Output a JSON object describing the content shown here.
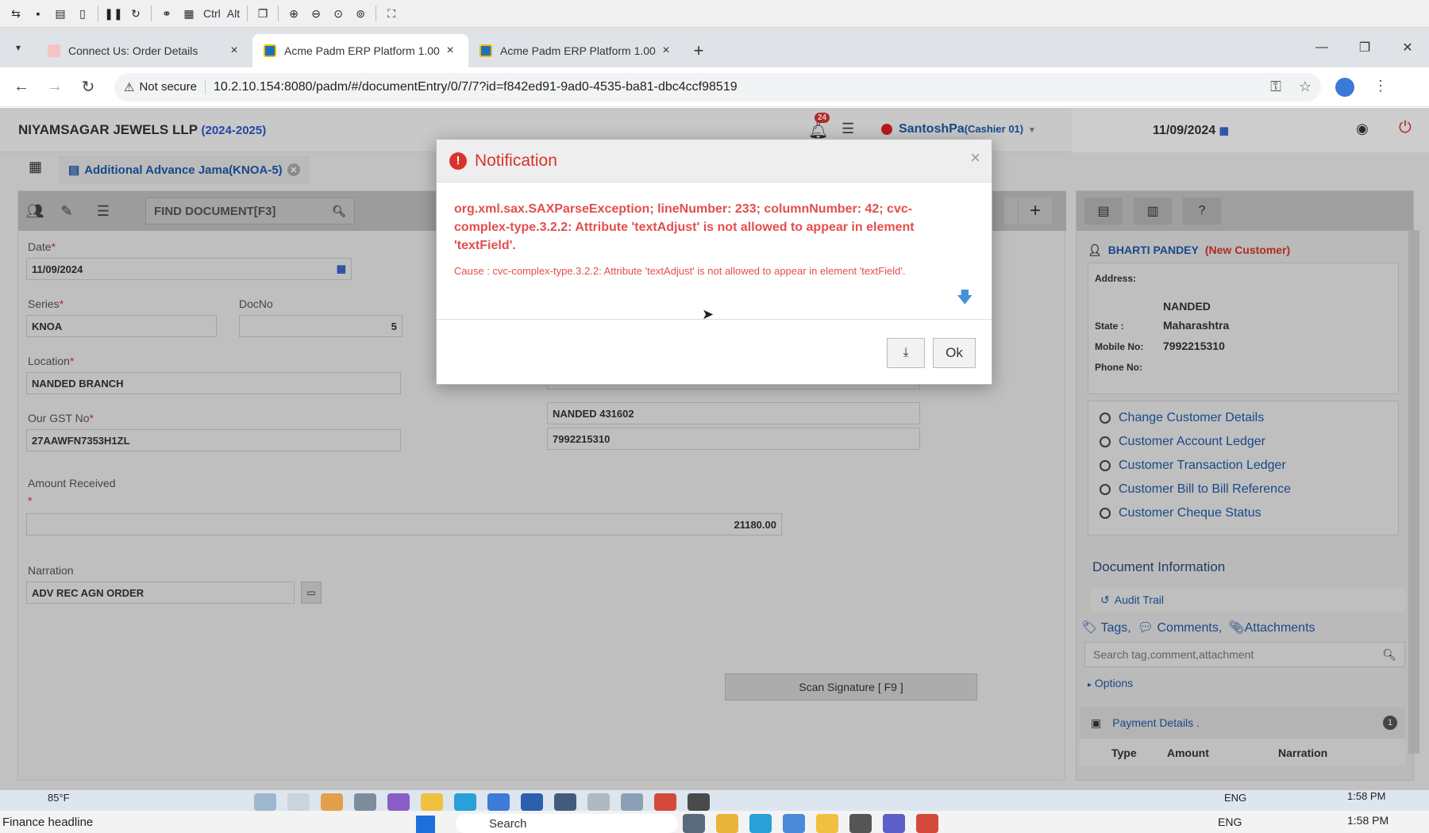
{
  "remote_toolbar": {
    "ctrl": "Ctrl",
    "alt": "Alt"
  },
  "browser": {
    "tabs": [
      {
        "title": "Connect Us: Order Details",
        "active": false
      },
      {
        "title": "Acme Padm ERP Platform 1.00",
        "active": true
      },
      {
        "title": "Acme Padm ERP Platform 1.00",
        "active": false
      }
    ],
    "security": "Not secure",
    "url": "10.2.10.154:8080/padm/#/documentEntry/0/7/7?id=f842ed91-9ad0-4535-ba81-dbc4ccf98519"
  },
  "header": {
    "company": "NIYAMSAGAR JEWELS LLP",
    "fin_year": "(2024-2025)",
    "notif_count": "24",
    "user": "SantoshPa",
    "role": "(Cashier 01)",
    "date": "11/09/2024"
  },
  "doc_tab": {
    "label": "Additional Advance Jama(KNOA-5)"
  },
  "toolbar": {
    "find_placeholder": "FIND DOCUMENT[F3]"
  },
  "form": {
    "date_label": "Date",
    "date_value": "11/09/2024",
    "series_label": "Series",
    "series_value": "KNOA",
    "docno_label": "DocNo",
    "docno_value": "5",
    "location_label": "Location",
    "location_value": "NANDED BRANCH",
    "gst_label": "Our GST No",
    "gst_value": "27AAWFN7353H1ZL",
    "amount_label": "Amount Received",
    "amount_value": "21180.00",
    "narration_label": "Narration",
    "narration_value": "ADV REC AGN ORDER",
    "addr_line": "NANDED 431602",
    "phone_line": "7992215310",
    "scan_signature": "Scan Signature [ F9 ]"
  },
  "customer": {
    "name": "BHARTI PANDEY",
    "tag": "(New Customer)",
    "address_label": "Address:",
    "city": "NANDED",
    "state_label": "State :",
    "state": "Maharashtra",
    "mobile_label": "Mobile No:",
    "mobile": "7992215310",
    "phone_label": "Phone No:",
    "links": [
      "Change Customer Details",
      "Customer Account Ledger",
      "Customer Transaction Ledger",
      "Customer Bill to Bill Reference",
      "Customer Cheque Status"
    ]
  },
  "doc_info": {
    "title": "Document Information",
    "audit_trail": "Audit Trail",
    "tags": "Tags,",
    "comments": "Comments,",
    "attachments": "Attachments",
    "search_placeholder": "Search tag,comment,attachment",
    "options": "Options",
    "payment_details": "Payment Details .",
    "payment_count": "1",
    "columns": [
      "Type",
      "Amount",
      "Narration"
    ]
  },
  "dialog": {
    "title": "Notification",
    "message": "org.xml.sax.SAXParseException; lineNumber: 233; columnNumber: 42; cvc-complex-type.3.2.2: Attribute 'textAdjust' is not allowed to appear in element 'textField'.",
    "cause": "Cause : cvc-complex-type.3.2.2: Attribute 'textAdjust' is not allowed to appear in element 'textField'.",
    "ok": "Ok"
  },
  "inner_taskbar": {
    "temp": "85°F",
    "lang": "ENG",
    "time": "1:58 PM"
  },
  "outer_taskbar": {
    "news": "Finance headline",
    "search": "Search",
    "lang": "ENG",
    "time": "1:58 PM"
  }
}
